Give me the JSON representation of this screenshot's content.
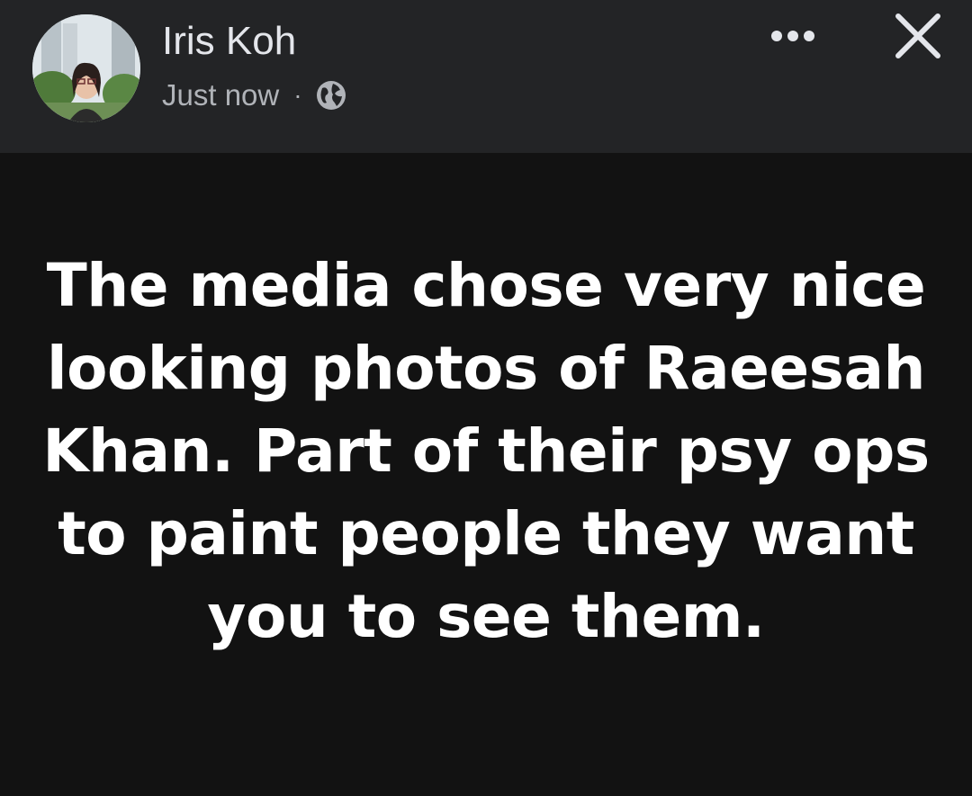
{
  "post": {
    "author": "Iris Koh",
    "timestamp": "Just now",
    "separator": "·",
    "audience_icon": "globe-icon",
    "body_text": "The media chose very nice looking photos of Raeesah Khan. Part of their psy ops to paint people they want you to see them."
  },
  "controls": {
    "more_icon": "more-options-icon",
    "close_icon": "close-icon"
  },
  "colors": {
    "header_bg": "#232426",
    "body_bg": "#121212",
    "author_text": "#e4e6eb",
    "meta_text": "#b0b3b8",
    "post_text": "#ffffff"
  }
}
